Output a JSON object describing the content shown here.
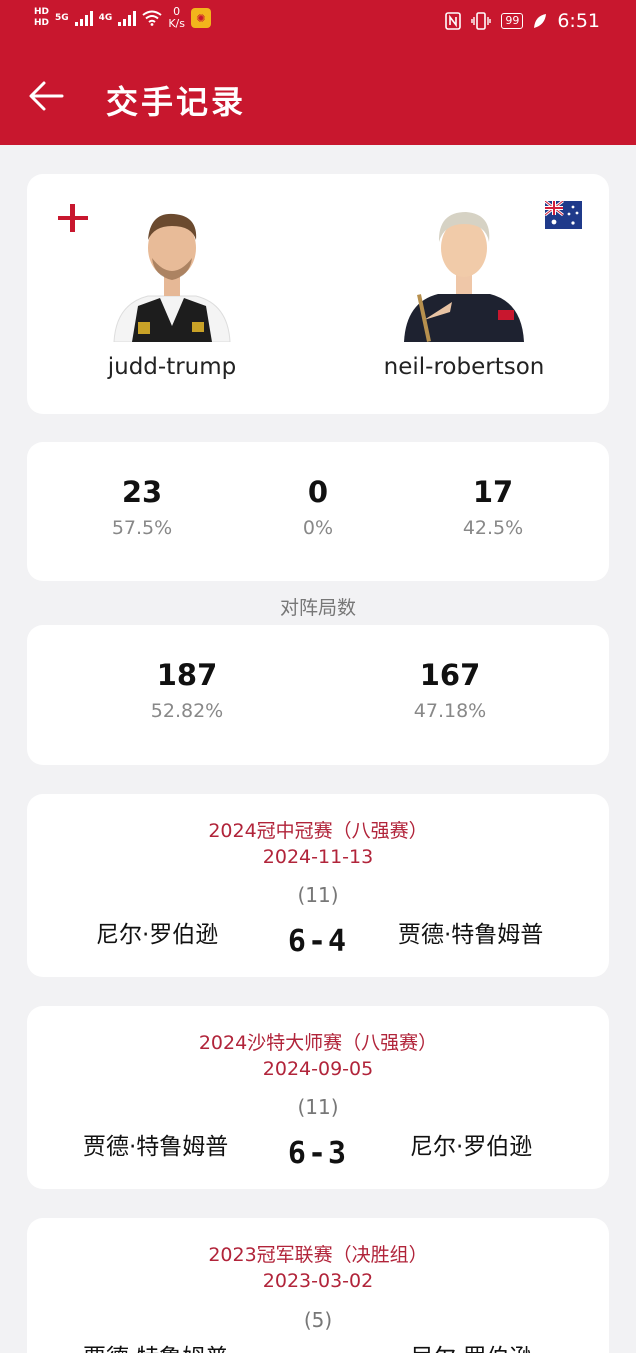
{
  "status_bar": {
    "hd1": "HD",
    "hd2": "HD",
    "net1": "5G",
    "net2": "4G",
    "speed_value": "0",
    "speed_unit": "K/s",
    "battery": "99",
    "time": "6:51",
    "icons": [
      "nfc-icon",
      "vibrate-icon",
      "battery-icon",
      "leaf-icon",
      "wifi-icon",
      "weibo-icon"
    ]
  },
  "header": {
    "title": "交手记录",
    "back_icon": "arrow-left-icon"
  },
  "players": {
    "left": {
      "name": "judd-trump",
      "flag": "england-flag-icon"
    },
    "right": {
      "name": "neil-robertson",
      "flag": "australia-flag-icon"
    }
  },
  "record": {
    "left": {
      "value": "23",
      "pct": "57.5%"
    },
    "draw": {
      "value": "0",
      "pct": "0%"
    },
    "right": {
      "value": "17",
      "pct": "42.5%"
    }
  },
  "frames_label": "对阵局数",
  "frames": {
    "left": {
      "value": "187",
      "pct": "52.82%"
    },
    "right": {
      "value": "167",
      "pct": "47.18%"
    }
  },
  "matches": [
    {
      "event": "2024冠中冠赛（八强赛）",
      "date": "2024-11-13",
      "frames": "(11)",
      "left_player": "尼尔·罗伯逊",
      "score": "6-4",
      "right_player": "贾德·特鲁姆普"
    },
    {
      "event": "2024沙特大师赛（八强赛）",
      "date": "2024-09-05",
      "frames": "(11)",
      "left_player": "贾德·特鲁姆普",
      "score": "6-3",
      "right_player": "尼尔·罗伯逊"
    },
    {
      "event": "2023冠军联赛（决胜组）",
      "date": "2023-03-02",
      "frames": "(5)",
      "left_player": "贾德·特鲁姆普",
      "score": "",
      "right_player": "尼尔·罗伯逊"
    }
  ],
  "colors": {
    "brand": "#c8172e",
    "event_text": "#b1243a",
    "background": "#f2f2f4"
  }
}
